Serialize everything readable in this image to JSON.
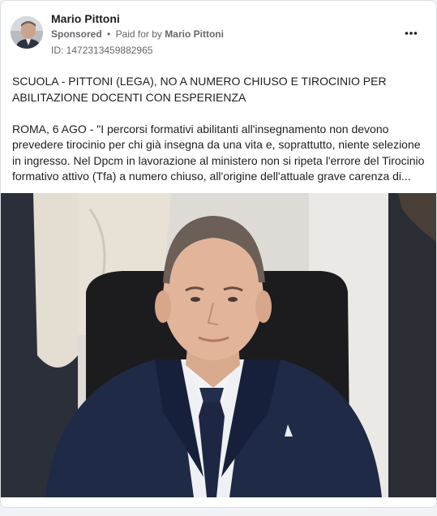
{
  "post": {
    "author_name": "Mario Pittoni",
    "sponsored_label": "Sponsored",
    "separator": "•",
    "paid_for_prefix": "Paid for by",
    "paid_for_name": "Mario Pittoni",
    "ad_id": "ID: 1472313459882965",
    "more_options_icon": "more-horizontal-icon",
    "headline": "SCUOLA - PITTONI (LEGA), NO A NUMERO CHIUSO E TIROCINIO PER ABILITAZIONE DOCENTI CON ESPERIENZA",
    "body": "ROMA, 6 AGO - \"I percorsi formativi abilitanti all'insegnamento non devono prevedere tirocinio per chi già insegna da una vita e, soprattutto, niente selezione in ingresso. Nel Dpcm in lavorazione al ministero non si ripeta l'errore del Tirocinio formativo attivo (Tfa) a numero chiuso, all'origine dell'attuale grave carenza di..."
  },
  "colors": {
    "background": "#f0f2f5",
    "card": "#ffffff",
    "primary_text": "#1c1e21",
    "secondary_text": "#65676b"
  }
}
